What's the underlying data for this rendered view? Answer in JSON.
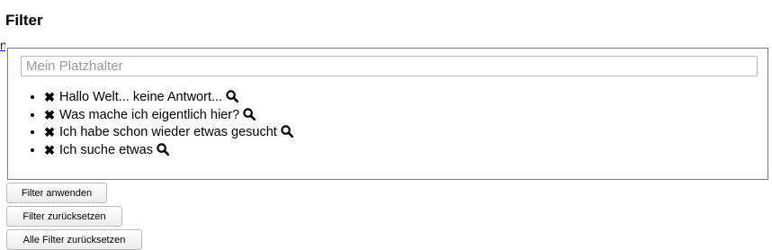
{
  "header": {
    "title": "Filter",
    "stray_link": "n"
  },
  "search": {
    "placeholder": "Mein Platzhalter",
    "value": ""
  },
  "terms": [
    {
      "label": "Hallo Welt... keine Antwort..."
    },
    {
      "label": "Was mache ich eigentlich hier?"
    },
    {
      "label": "Ich habe schon wieder etwas gesucht"
    },
    {
      "label": "Ich suche etwas"
    }
  ],
  "icons": {
    "remove": "close-icon",
    "search": "search-icon"
  },
  "buttons": {
    "apply": "Filter anwenden",
    "reset": "Filter zurücksetzen",
    "reset_all": "Alle Filter zurücksetzen"
  }
}
